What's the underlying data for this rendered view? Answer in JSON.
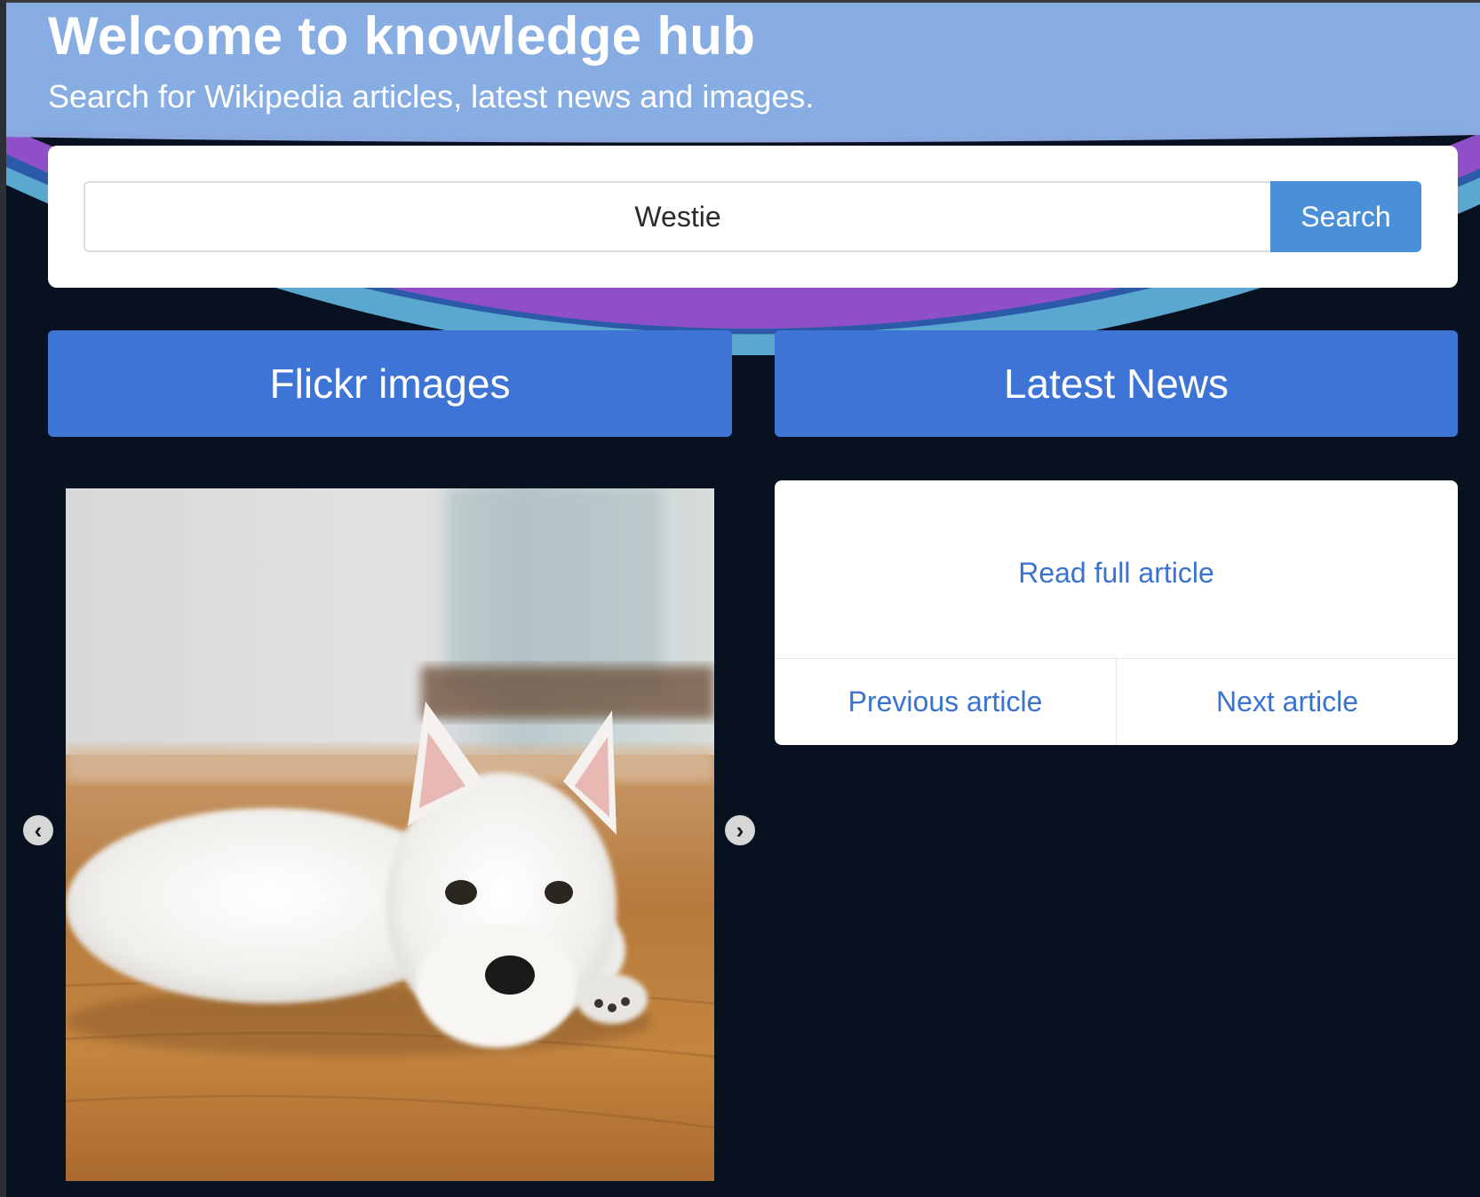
{
  "hero": {
    "title": "Welcome to knowledge hub",
    "subtitle": "Search for Wikipedia articles, latest news and images."
  },
  "search": {
    "value": "Westie",
    "button_label": "Search"
  },
  "sections": {
    "flickr_title": "Flickr images",
    "news_title": "Latest News"
  },
  "carousel": {
    "prev_icon": "chevron-left-icon",
    "next_icon": "chevron-right-icon"
  },
  "news": {
    "read_full_label": "Read full article",
    "previous_label": "Previous article",
    "next_label": "Next article"
  },
  "colors": {
    "hero_blue": "#87ade3",
    "page_background": "#07111f",
    "section_header": "#3e74d6",
    "search_button": "#4a90d9",
    "link_blue": "#3a73cf"
  }
}
